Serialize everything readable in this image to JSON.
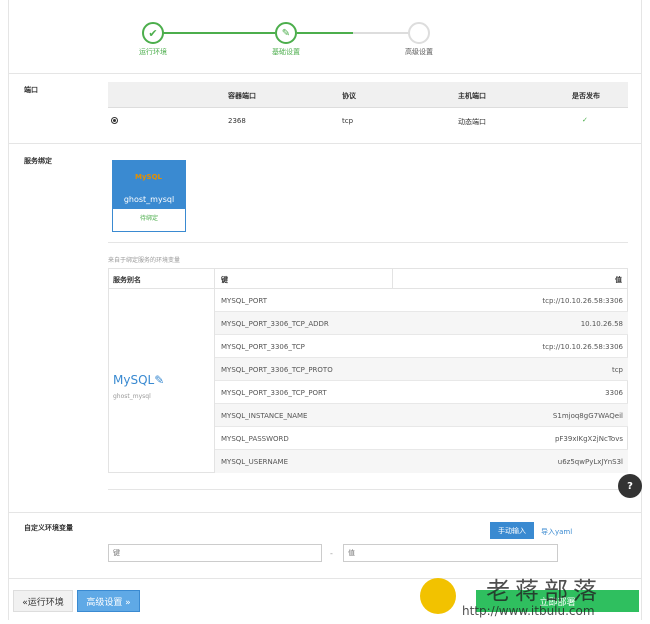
{
  "stepper": {
    "steps": [
      {
        "label": "运行环境",
        "state": "done",
        "icon": "check-icon"
      },
      {
        "label": "基础设置",
        "state": "active",
        "icon": "edit-icon"
      },
      {
        "label": "高级设置",
        "state": "todo",
        "icon": ""
      }
    ]
  },
  "ports": {
    "section_title": "端口",
    "headers": [
      "容器端口",
      "协议",
      "主机端口",
      "是否发布"
    ],
    "rows": [
      {
        "container_port": "2368",
        "protocol": "tcp",
        "host_port": "动态端口",
        "published": "check-circle-icon"
      }
    ]
  },
  "service_binding": {
    "section_title": "服务绑定",
    "card": {
      "logo_text": "MySQL",
      "name": "ghost_mysql",
      "status": "待绑定"
    },
    "env_caption": "来自于绑定服务的环境变量",
    "env_headers": {
      "service_alias": "服务别名",
      "key": "键",
      "value": "值"
    },
    "service_label": "MySQL",
    "service_sub": "ghost_mysql",
    "env_rows": [
      {
        "key": "MYSQL_PORT",
        "value": "tcp://10.10.26.58:3306"
      },
      {
        "key": "MYSQL_PORT_3306_TCP_ADDR",
        "value": "10.10.26.58"
      },
      {
        "key": "MYSQL_PORT_3306_TCP",
        "value": "tcp://10.10.26.58:3306"
      },
      {
        "key": "MYSQL_PORT_3306_TCP_PROTO",
        "value": "tcp"
      },
      {
        "key": "MYSQL_PORT_3306_TCP_PORT",
        "value": "3306"
      },
      {
        "key": "MYSQL_INSTANCE_NAME",
        "value": "S1mjoq8gG7WAQeil"
      },
      {
        "key": "MYSQL_PASSWORD",
        "value": "pF39xIKgX2jNcTovs"
      },
      {
        "key": "MYSQL_USERNAME",
        "value": "u6z5qwPyLxJYnS3l"
      }
    ]
  },
  "custom_env": {
    "section_title": "自定义环境变量",
    "manual_button": "手动输入",
    "import_link": "导入yaml",
    "key_placeholder": "键",
    "value_placeholder": "值",
    "separator": "-"
  },
  "footer": {
    "back_button": "«运行环境",
    "next_button": "高级设置 »",
    "deploy_button": "立即部署"
  },
  "help": {
    "label": "?"
  },
  "watermark": {
    "text": "老蒋部落",
    "url": "http://www.itbulu.com"
  },
  "colors": {
    "accent": "#3a8ad1",
    "success": "#4cae4c",
    "deploy": "#2fbf5f"
  }
}
